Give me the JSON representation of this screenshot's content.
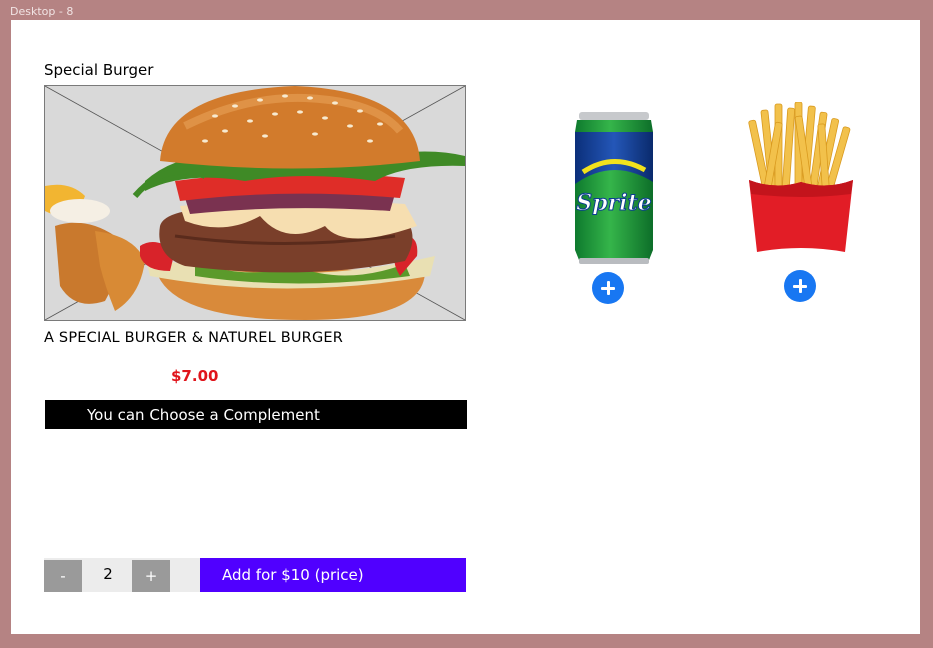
{
  "frame": {
    "label": "Desktop - 8"
  },
  "product": {
    "title": "Special Burger",
    "description": "A  SPECIAL BURGER & NATUREL BURGER",
    "price": "$7.00"
  },
  "complement": {
    "prompt": "You can Choose a Complement",
    "items": [
      {
        "name": "sprite-can",
        "icon": "sprite-can-image"
      },
      {
        "name": "french-fries",
        "icon": "french-fries-image"
      }
    ]
  },
  "quantity": {
    "minus_label": "-",
    "value": "2",
    "plus_label": "+"
  },
  "add_button": {
    "label": "Add for $10 (price)"
  },
  "colors": {
    "frame_bg": "#b58383",
    "price": "#e0141b",
    "add_button": "#5000ff",
    "plus_circle": "#1877f2",
    "complement_bar": "#000000"
  }
}
